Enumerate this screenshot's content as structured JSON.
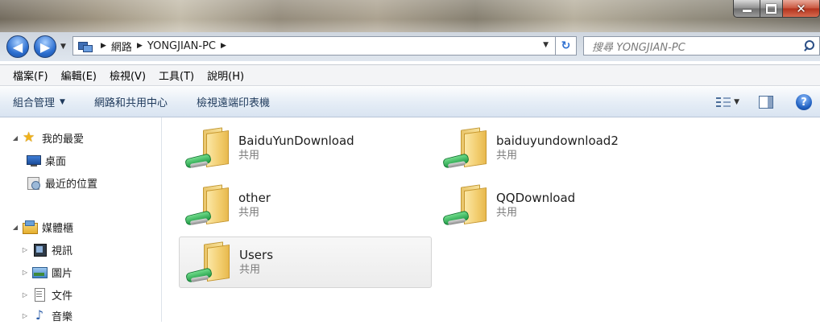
{
  "window": {
    "minimize_label": "—",
    "maximize_label": "□",
    "close_label": "✕"
  },
  "nav": {
    "back_label": "◀",
    "forward_label": "▶"
  },
  "address": {
    "breadcrumbs": [
      "網路",
      "YONGJIAN-PC"
    ]
  },
  "search": {
    "placeholder": "搜尋 YONGJIAN-PC"
  },
  "menu": {
    "items": [
      "檔案(F)",
      "編輯(E)",
      "檢視(V)",
      "工具(T)",
      "說明(H)"
    ]
  },
  "commands": {
    "organize": "組合管理",
    "network_center": "網路和共用中心",
    "view_printers": "檢視遠端印表機"
  },
  "sidebar": {
    "favorites": "我的最愛",
    "desktop": "桌面",
    "recent": "最近的位置",
    "libraries": "媒體櫃",
    "videos": "視訊",
    "pictures": "圖片",
    "documents": "文件",
    "music": "音樂"
  },
  "shares": [
    {
      "name": "BaiduYunDownload",
      "status": "共用"
    },
    {
      "name": "baiduyundownload2",
      "status": "共用"
    },
    {
      "name": "other",
      "status": "共用"
    },
    {
      "name": "QQDownload",
      "status": "共用"
    },
    {
      "name": "Users",
      "status": "共用"
    }
  ],
  "icons": {
    "back": "back-arrow-icon",
    "forward": "forward-arrow-icon",
    "search": "search-icon",
    "favorites": "star-icon",
    "share_folder": "shared-folder-icon"
  }
}
